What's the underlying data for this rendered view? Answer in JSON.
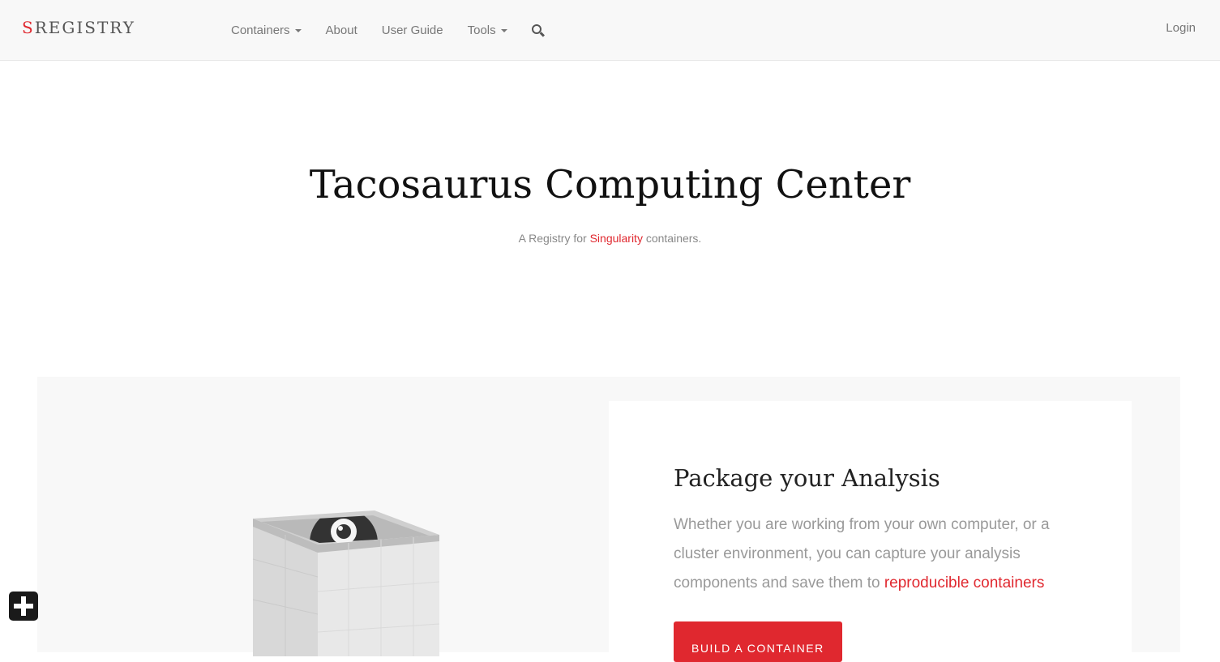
{
  "navbar": {
    "brand_s": "S",
    "brand_rest": "REGISTRY",
    "items": [
      {
        "label": "Containers",
        "dropdown": true
      },
      {
        "label": "About",
        "dropdown": false
      },
      {
        "label": "User Guide",
        "dropdown": false
      },
      {
        "label": "Tools",
        "dropdown": true
      }
    ],
    "search_icon": "search-icon",
    "login_label": "Login"
  },
  "hero": {
    "title": "Tacosaurus Computing Center",
    "subtitle_prefix": "A Registry for ",
    "subtitle_link": "Singularity",
    "subtitle_suffix": " containers."
  },
  "feature": {
    "title": "Package your Analysis",
    "text": "Whether you are working from your own computer, or a cluster environment, you can capture your analysis components and save them to ",
    "text_link": "reproducible containers",
    "button_label": "Build a Container"
  },
  "colors": {
    "accent": "#e0282f",
    "navbar_bg": "#f8f8f8",
    "section_bg": "#f8f8f8"
  },
  "floating_button_icon": "plus-icon"
}
